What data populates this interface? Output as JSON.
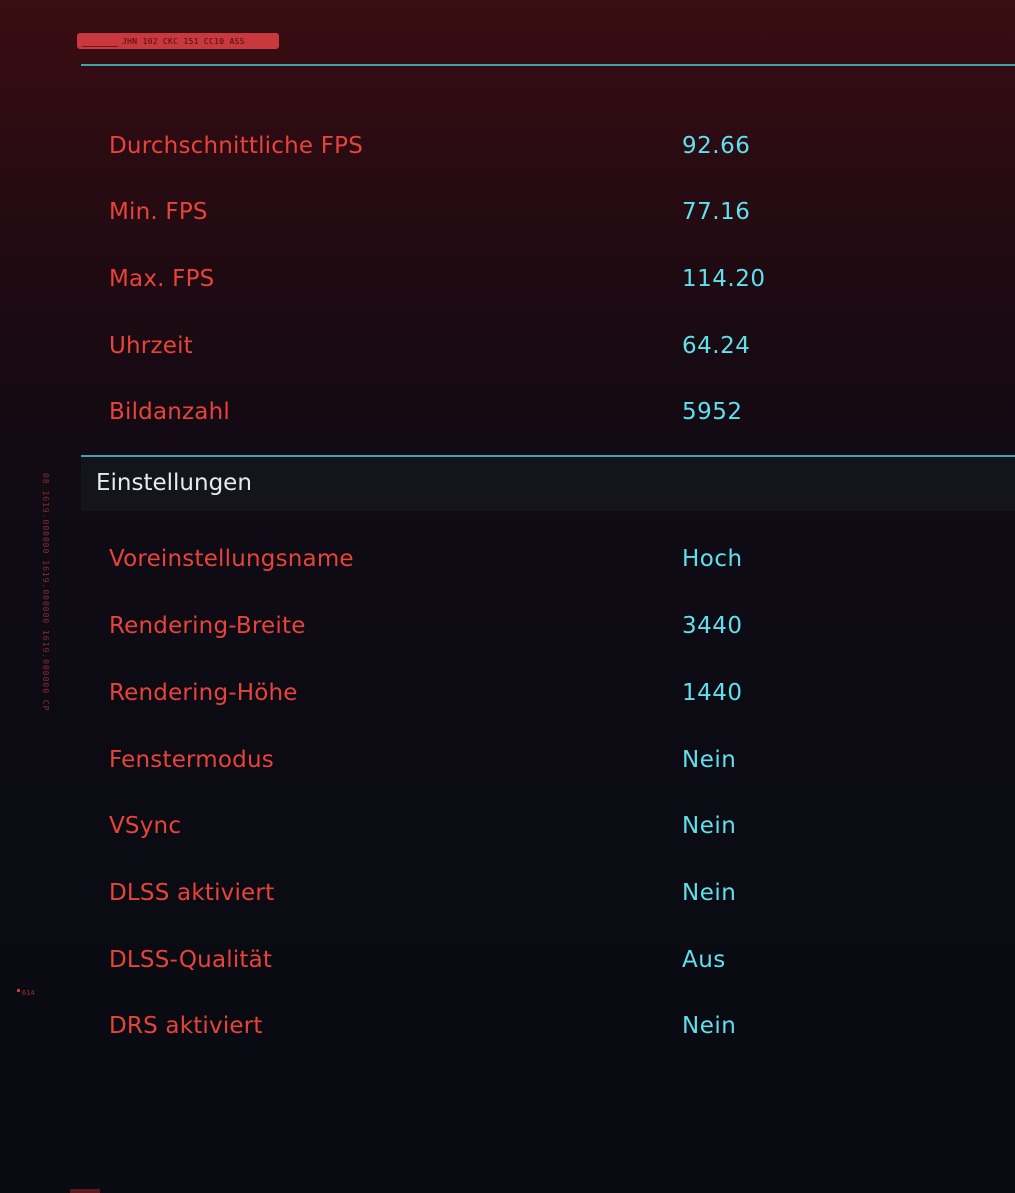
{
  "header": {
    "code_tag": "JHN 102 CKC 151 CC10 ASS",
    "side_code": "08 1619.000000 1619.000000 1619.000000 CP",
    "side_mark": "614"
  },
  "results": {
    "rows": [
      {
        "label": "Durchschnittliche FPS",
        "value": "92.66"
      },
      {
        "label": "Min. FPS",
        "value": "77.16"
      },
      {
        "label": "Max. FPS",
        "value": "114.20"
      },
      {
        "label": "Uhrzeit",
        "value": "64.24"
      },
      {
        "label": "Bildanzahl",
        "value": "5952"
      }
    ]
  },
  "settings": {
    "title": "Einstellungen",
    "rows": [
      {
        "label": "Voreinstellungsname",
        "value": "Hoch"
      },
      {
        "label": "Rendering-Breite",
        "value": "3440"
      },
      {
        "label": "Rendering-Höhe",
        "value": "1440"
      },
      {
        "label": "Fenstermodus",
        "value": "Nein"
      },
      {
        "label": "VSync",
        "value": "Nein"
      },
      {
        "label": "DLSS aktiviert",
        "value": "Nein"
      },
      {
        "label": "DLSS-Qualität",
        "value": "Aus"
      },
      {
        "label": "DRS aktiviert",
        "value": "Nein"
      }
    ]
  },
  "colors": {
    "label": "#e8433b",
    "value": "#5fe0ec",
    "accent_rule": "#3fa3ac",
    "tag": "#c8383c"
  }
}
